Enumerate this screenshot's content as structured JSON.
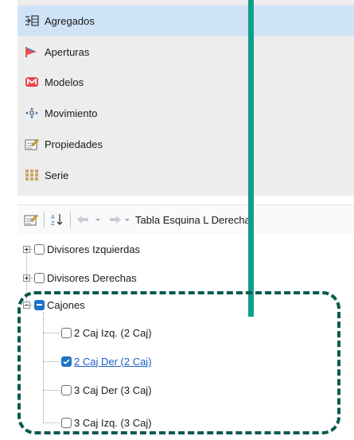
{
  "panel": {
    "items": [
      {
        "label": "Agregados",
        "icon": "aggregate-icon",
        "selected": true
      },
      {
        "label": "Aperturas",
        "icon": "opening-flag-icon",
        "selected": false
      },
      {
        "label": "Modelos",
        "icon": "models-icon",
        "selected": false
      },
      {
        "label": "Movimiento",
        "icon": "move-icon",
        "selected": false
      },
      {
        "label": "Propiedades",
        "icon": "properties-icon",
        "selected": false
      },
      {
        "label": "Serie",
        "icon": "series-icon",
        "selected": false
      }
    ]
  },
  "toolbar": {
    "title": "Tabla Esquina L Derecha",
    "icons": [
      "properties-icon",
      "sort-alpha-icon",
      "back-arrow-icon",
      "forward-arrow-icon"
    ]
  },
  "tree": {
    "nodes": [
      {
        "label": "Divisores Izquierdas",
        "expanded": false,
        "checked": false
      },
      {
        "label": "Divisores Derechas",
        "expanded": false,
        "checked": false
      },
      {
        "label": "Cajones",
        "expanded": true,
        "checked": "indeterminate",
        "children": [
          {
            "label": "2 Caj Izq. (2 Caj)",
            "checked": false
          },
          {
            "label": "2 Caj Der (2 Caj)",
            "checked": true
          },
          {
            "label": "3 Caj Der (3 Caj)",
            "checked": false
          },
          {
            "label": "3 Caj Izq. (3 Caj)",
            "checked": false
          }
        ]
      }
    ]
  },
  "colors": {
    "selected_row": "#cfe3f7",
    "checkbox_accent": "#1a73c8",
    "link_text": "#1a5fc8",
    "annotation_line": "#0e9e8c",
    "annotation_box": "#0a5a4f"
  }
}
